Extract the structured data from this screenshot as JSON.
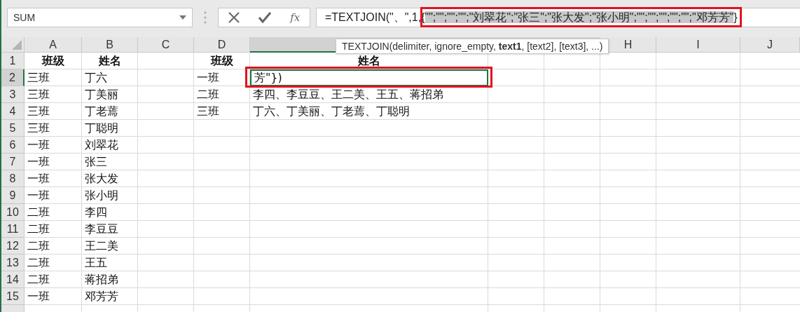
{
  "name_box": {
    "value": "SUM"
  },
  "formula_bar": {
    "function_button": "fx",
    "formula": {
      "before": "=TEXTJOIN(\"、\",1,",
      "open": "{",
      "highlighted": "\"\";\"\";\"\";\"\";\"刘翠花\";\"张三\";\"张大发\";\"张小明\";\"\";\"\";\"\";\"\";\"\";\"邓芳芳\"",
      "close": "}"
    }
  },
  "tooltip": {
    "text": "TEXTJOIN(delimiter, ignore_empty, **text1**, [text2], [text3], ...)"
  },
  "columns": [
    {
      "label": "A",
      "selected": false
    },
    {
      "label": "B",
      "selected": false
    },
    {
      "label": "C",
      "selected": false
    },
    {
      "label": "D",
      "selected": false
    },
    {
      "selected": true
    },
    {
      "label": "H",
      "selected": false
    },
    {
      "label": "I",
      "selected": false
    },
    {
      "label": "J",
      "selected": false
    }
  ],
  "row_numbers": [
    {
      "label": "1",
      "selected": false
    },
    {
      "label": "2",
      "selected": true
    },
    {
      "label": "3",
      "selected": false
    },
    {
      "label": "4",
      "selected": false
    },
    {
      "label": "5",
      "selected": false
    },
    {
      "label": "6",
      "selected": false
    },
    {
      "label": "7",
      "selected": false
    },
    {
      "label": "8",
      "selected": false
    },
    {
      "label": "9",
      "selected": false
    },
    {
      "label": "10",
      "selected": false
    },
    {
      "label": "11",
      "selected": false
    },
    {
      "label": "12",
      "selected": false
    },
    {
      "label": "13",
      "selected": false
    },
    {
      "label": "14",
      "selected": false
    },
    {
      "label": "15",
      "selected": false
    }
  ],
  "source_table": {
    "headers": [
      "班级",
      "姓名"
    ],
    "rows": [
      [
        "三班",
        "丁六"
      ],
      [
        "三班",
        "丁美丽"
      ],
      [
        "三班",
        "丁老蔫"
      ],
      [
        "三班",
        "丁聪明"
      ],
      [
        "一班",
        "刘翠花"
      ],
      [
        "一班",
        "张三"
      ],
      [
        "一班",
        "张大发"
      ],
      [
        "一班",
        "张小明"
      ],
      [
        "二班",
        "李四"
      ],
      [
        "二班",
        "李豆豆"
      ],
      [
        "二班",
        "王二美"
      ],
      [
        "二班",
        "王五"
      ],
      [
        "二班",
        "蒋招弟"
      ],
      [
        "一班",
        "邓芳芳"
      ]
    ]
  },
  "result_table": {
    "headers": [
      "班级",
      "姓名"
    ],
    "rows": [
      {
        "class": "一班",
        "names": "芳\"})",
        "editing": true
      },
      {
        "class": "二班",
        "names": "李四、李豆豆、王二美、王五、蒋招弟",
        "editing": false
      },
      {
        "class": "三班",
        "names": "丁六、丁美丽、丁老蔫、丁聪明",
        "editing": false
      }
    ]
  }
}
